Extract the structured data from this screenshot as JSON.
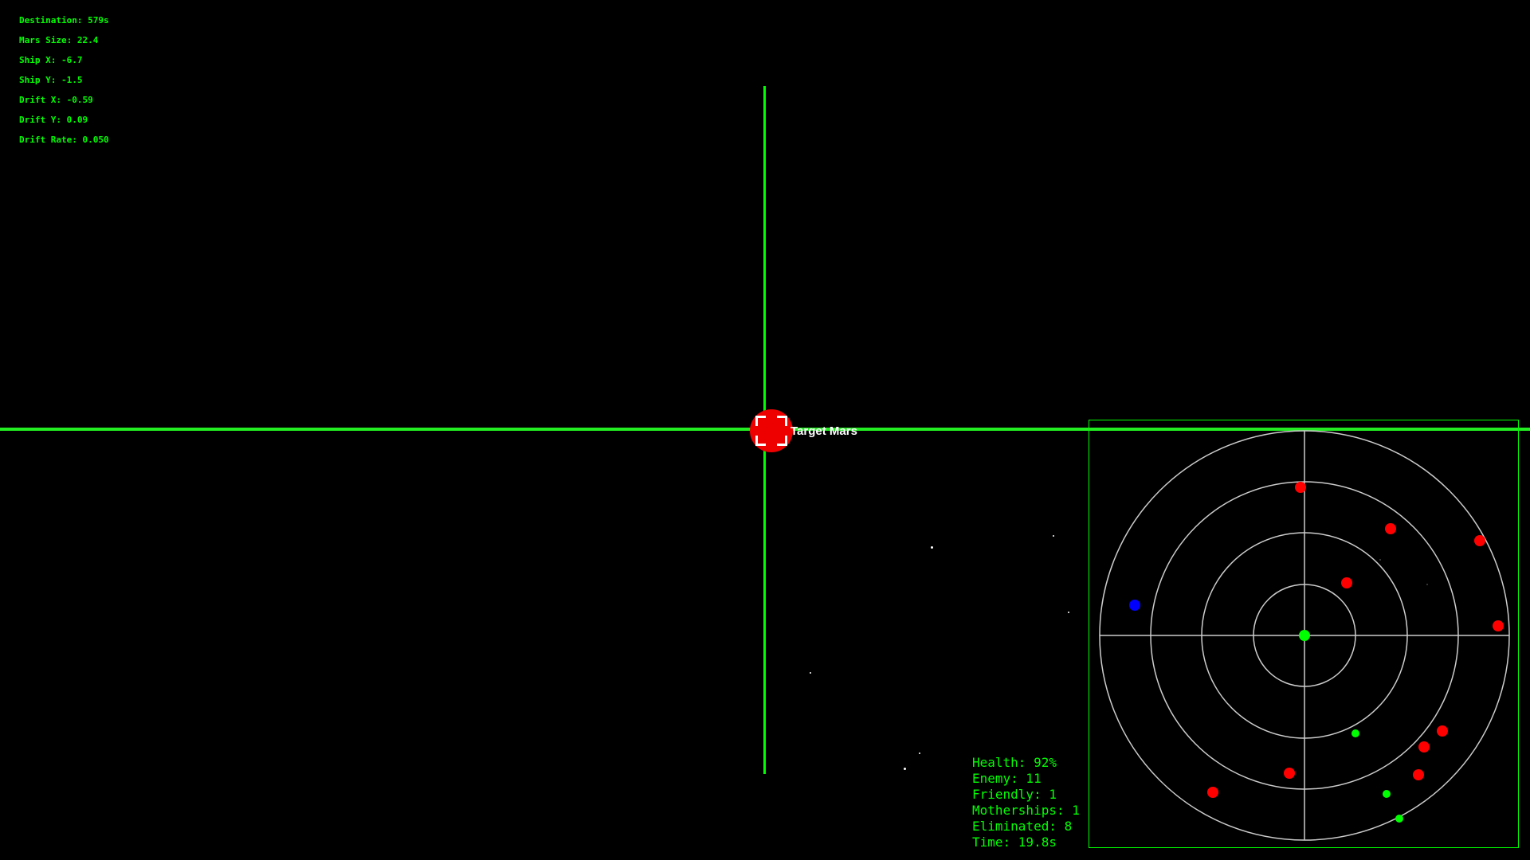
{
  "debug": {
    "destination": "Destination: 579s",
    "mars_size": "Mars Size: 22.4",
    "ship_x": "Ship X: -6.7",
    "ship_y": "Ship Y: -1.5",
    "drift_x": "Drift X: -0.59",
    "drift_y": "Drift Y: 0.09",
    "drift_rate": "Drift Rate: 0.050"
  },
  "target": {
    "label": "Target Mars"
  },
  "status": {
    "health": "Health: 92%",
    "enemy": "Enemy: 11",
    "friendly": "Friendly: 1",
    "motherships": "Motherships: 1",
    "eliminated": "Eliminated: 8",
    "time": "Time: 19.8s"
  },
  "colors": {
    "hud": "#00ff00",
    "enemy": "#ff0000",
    "friendly": "#00ff00",
    "mothership": "#0000ff",
    "radar_rings": "#cccccc"
  }
}
